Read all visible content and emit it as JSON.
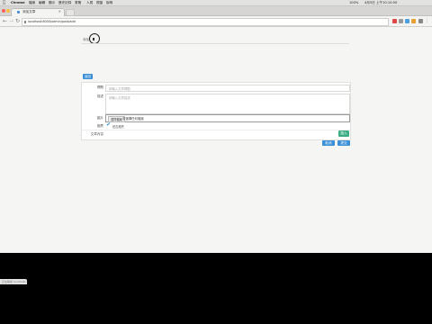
{
  "menubar": {
    "apple_icon": "apple-icon",
    "items": [
      "Chrome",
      "檔案",
      "編輯",
      "顯示",
      "歷史記錄",
      "書籤",
      "人員",
      "視窗",
      "說明"
    ],
    "status": [
      "100%",
      "4月5日 上午10:10:00"
    ]
  },
  "browser": {
    "tab_title": "添加文章",
    "url": "localhost:8000/admin/post/add",
    "colors": {
      "close": "#fc605c",
      "min": "#fdbc40",
      "max": "#34c84a"
    }
  },
  "page": {
    "breadcrumb": "添加",
    "top_button": "返回",
    "form": {
      "title_label": "標題",
      "title_placeholder": "請輸入文章標題",
      "desc_label": "描述",
      "desc_placeholder": "請輸入文章描述",
      "image_label": "圖片",
      "file_button": "選擇檔案",
      "file_status": "未選擇任何檔案",
      "recommend_label": "推薦",
      "recommend_option": "是否推薦",
      "content_label": "文章內容",
      "editor_button": "插入"
    },
    "cancel_button": "取消",
    "submit_button": "提交"
  },
  "statusbar": {
    "text": "正在等候 localhost..."
  }
}
